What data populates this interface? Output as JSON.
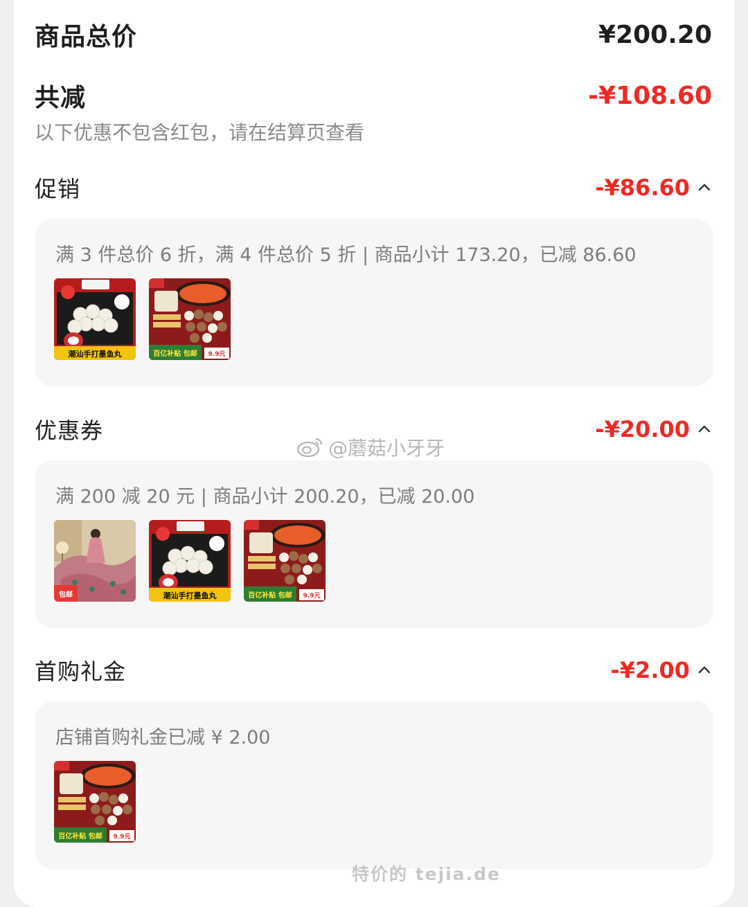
{
  "summary": {
    "total_label": "商品总价",
    "total_value": "¥200.20",
    "discount_label": "共减",
    "discount_value": "-¥108.60",
    "note": "以下优惠不包含红包，请在结算页查看"
  },
  "sections": [
    {
      "title": "促销",
      "amount": "-¥86.60",
      "desc": "满 3 件总价 6 折，满 4 件总价 5 折 | 商品小计 173.20，已减 86.60",
      "thumbs": [
        {
          "kind": "fishball",
          "caption": "潮汕手打墨鱼丸"
        },
        {
          "kind": "hotpot",
          "caption": "百亿补贴 包邮",
          "price": "9.9元"
        }
      ]
    },
    {
      "title": "优惠券",
      "amount": "-¥20.00",
      "desc": "满 200 减 20 元 | 商品小计 200.20，已减 20.00",
      "thumbs": [
        {
          "kind": "bedding",
          "caption": "包邮"
        },
        {
          "kind": "fishball",
          "caption": "潮汕手打墨鱼丸"
        },
        {
          "kind": "hotpot",
          "caption": "百亿补贴 包邮",
          "price": "9.9元"
        }
      ]
    },
    {
      "title": "首购礼金",
      "amount": "-¥2.00",
      "desc": "店铺首购礼金已减 ¥ 2.00",
      "thumbs": [
        {
          "kind": "hotpot",
          "caption": "百亿补贴 包邮",
          "price": "9.9元"
        }
      ]
    }
  ],
  "watermark": "@蘑菇小牙牙",
  "footer_mark": "特价的 tejia.de",
  "colors": {
    "accent_red": "#ee2a24",
    "panel_bg": "#f6f6f6",
    "muted_text": "#8a8a8a"
  },
  "icons": {
    "collapse": "chevron-up-icon",
    "weibo": "weibo-icon"
  }
}
